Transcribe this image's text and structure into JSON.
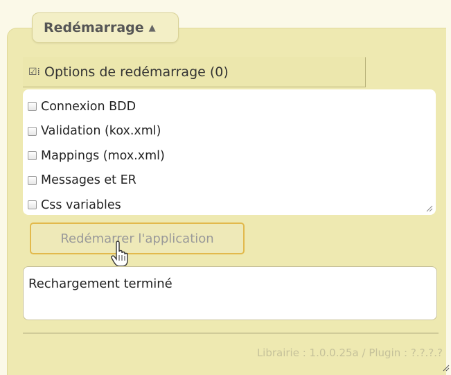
{
  "tab": {
    "label": "Redémarrage",
    "arrow_icon": "▲"
  },
  "options": {
    "header_icon": "☑⁞",
    "header_label": "Options de redémarrage (0)",
    "items": [
      {
        "label": "Connexion BDD",
        "checked": false
      },
      {
        "label": "Validation (kox.xml)",
        "checked": false
      },
      {
        "label": "Mappings (mox.xml)",
        "checked": false
      },
      {
        "label": "Messages et ER",
        "checked": false
      },
      {
        "label": "Css variables",
        "checked": false
      }
    ]
  },
  "restart_button": {
    "label": "Redémarrer l'application"
  },
  "status": {
    "message": "Rechargement terminé"
  },
  "footer": {
    "version": "Librairie : 1.0.0.25a / Plugin : ?.?.?.?"
  },
  "colors": {
    "panel": "#eee9b1",
    "button_border": "#e2b94c"
  }
}
